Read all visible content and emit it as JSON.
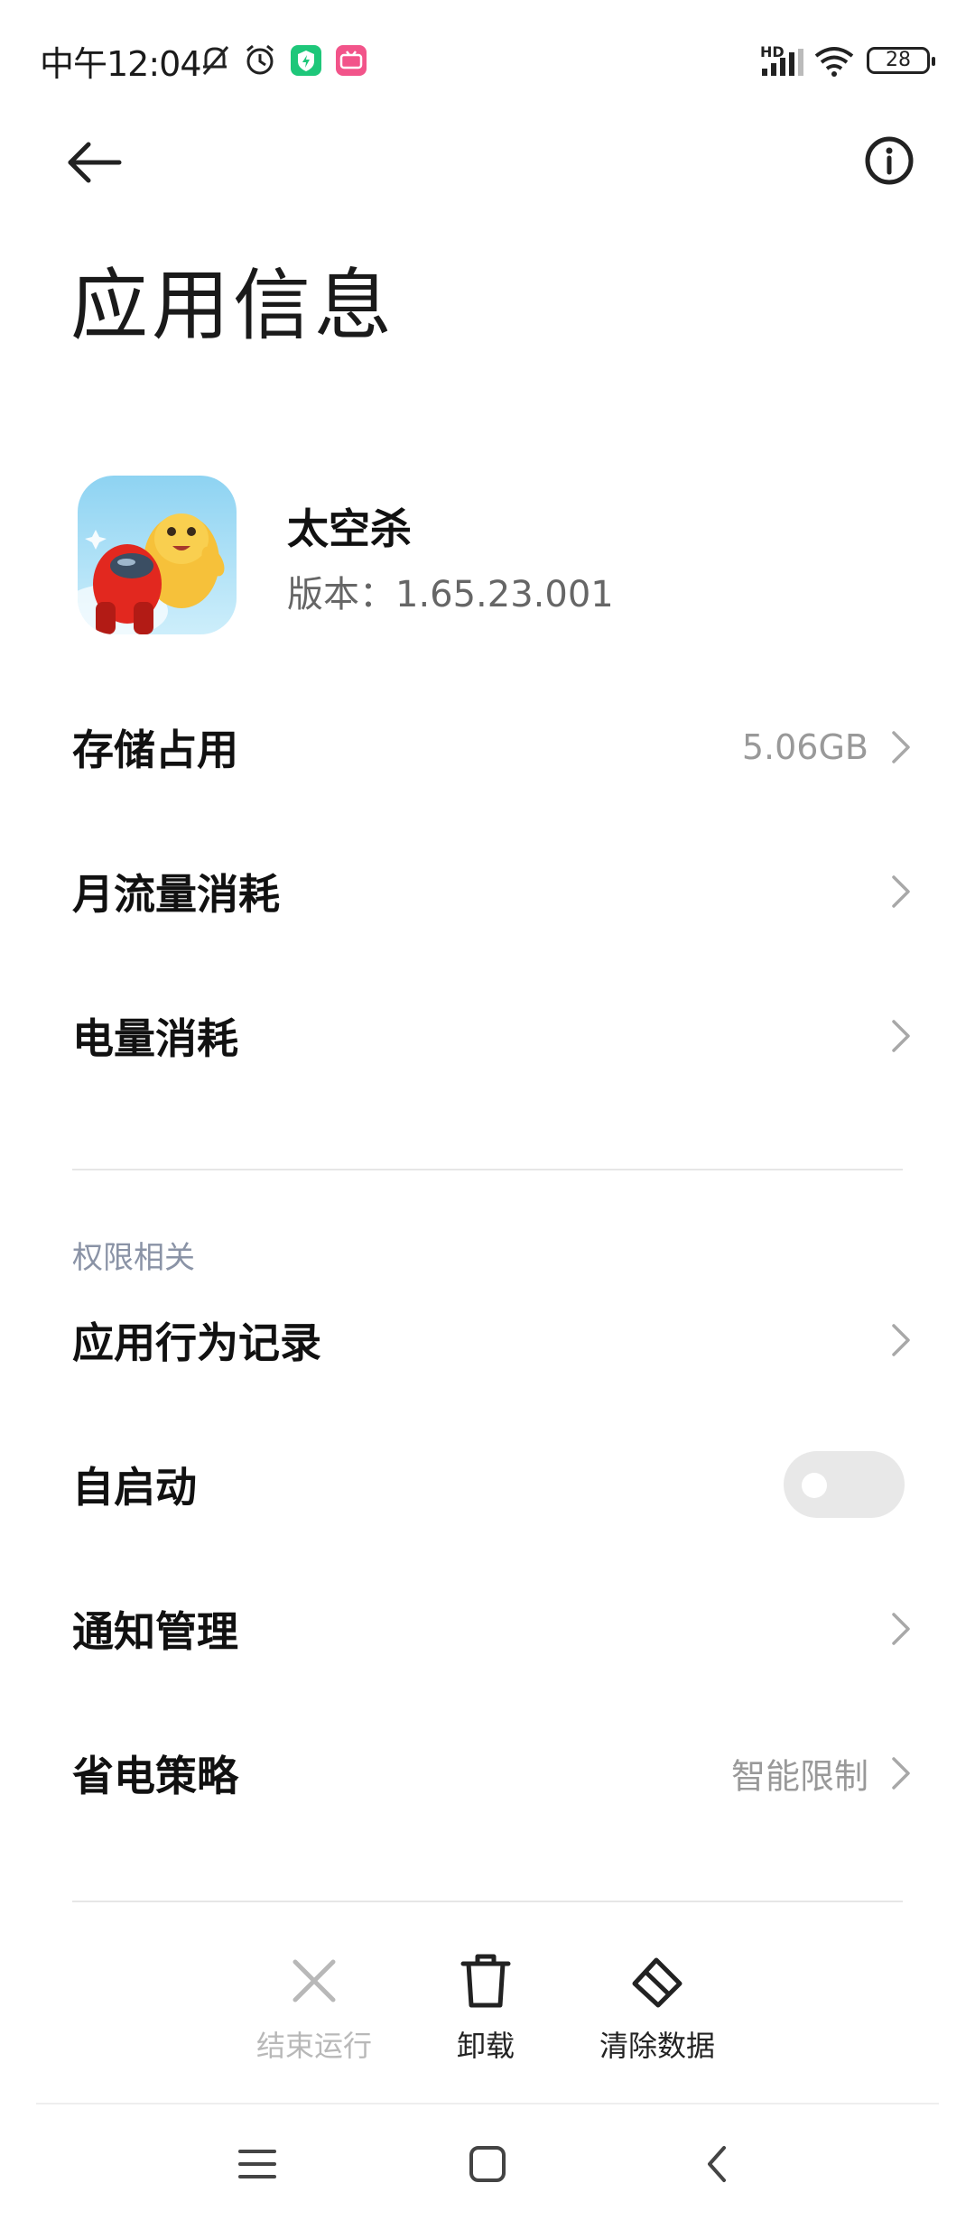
{
  "status_bar": {
    "time": "中午12:04",
    "network_label": "HD",
    "battery": "28",
    "icons": [
      "mute-bell-icon",
      "alarm-icon",
      "security-app-icon",
      "live-app-icon",
      "signal-icon",
      "wifi-icon",
      "battery-icon"
    ]
  },
  "header": {
    "title": "应用信息"
  },
  "app": {
    "name": "太空杀",
    "version": "版本：1.65.23.001"
  },
  "rows": {
    "storage": {
      "label": "存储占用",
      "value": "5.06GB"
    },
    "data_usage": {
      "label": "月流量消耗"
    },
    "battery_usage": {
      "label": "电量消耗"
    }
  },
  "permissions": {
    "section_title": "权限相关",
    "behavior_log": {
      "label": "应用行为记录"
    },
    "autostart": {
      "label": "自启动",
      "enabled": false
    },
    "notifications": {
      "label": "通知管理"
    },
    "battery_saver": {
      "label": "省电策略",
      "value": "智能限制"
    }
  },
  "actions": {
    "force_stop": {
      "label": "结束运行",
      "enabled": false
    },
    "uninstall": {
      "label": "卸载"
    },
    "clear_data": {
      "label": "清除数据"
    }
  },
  "colors": {
    "section_header": "#8a93a6",
    "secondary_text": "#999999",
    "toggle_off": "#e8e8e8",
    "app_badge_green": "#1ec77a",
    "app_badge_pink": "#f2548a"
  }
}
